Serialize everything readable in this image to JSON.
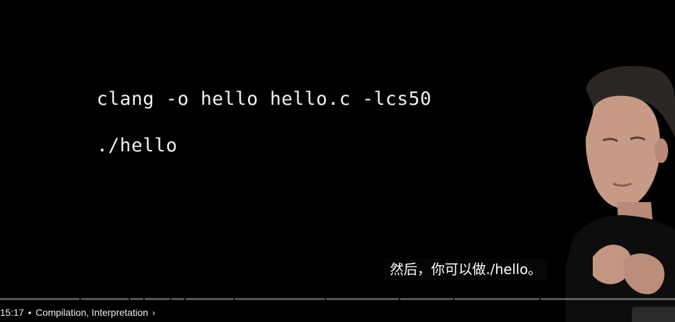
{
  "slide": {
    "line1": "clang -o hello hello.c -lcs50",
    "line2": "./hello"
  },
  "subtitle": {
    "text": "然后，你可以做./hello。"
  },
  "controls": {
    "time": "15:17",
    "separator": "•",
    "chapter": "Compilation, Interpretation",
    "chevron": "›"
  },
  "colors": {
    "background": "#000000",
    "text": "#f2f2f2",
    "progress_unplayed": "rgba(255,255,255,0.35)"
  },
  "icons": {
    "chapter_chevron": "chevron-right-icon"
  }
}
